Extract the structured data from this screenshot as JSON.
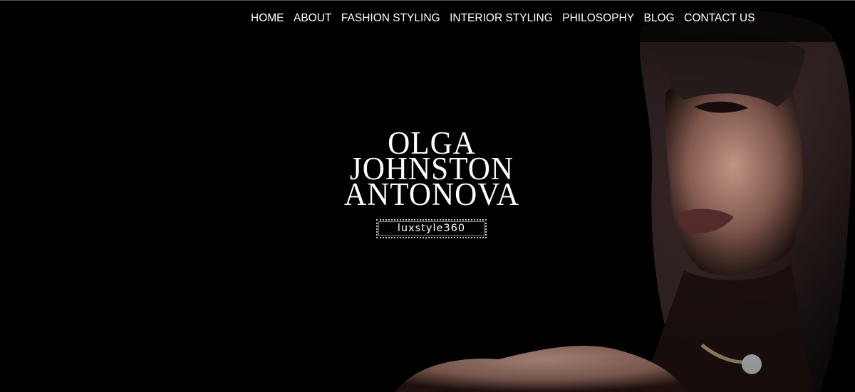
{
  "nav": {
    "items": [
      {
        "label": "HOME"
      },
      {
        "label": "ABOUT"
      },
      {
        "label": "FASHION STYLING"
      },
      {
        "label": "INTERIOR STYLING"
      },
      {
        "label": "PHILOSOPHY"
      },
      {
        "label": "BLOG"
      },
      {
        "label": "CONTACT US"
      }
    ]
  },
  "logo": {
    "line1": "OLGA",
    "line2": "JOHNSTON",
    "line3": "ANTONOVA"
  },
  "tagline": "luxstyle360",
  "colors": {
    "background": "#000000",
    "text": "#ffffff"
  }
}
